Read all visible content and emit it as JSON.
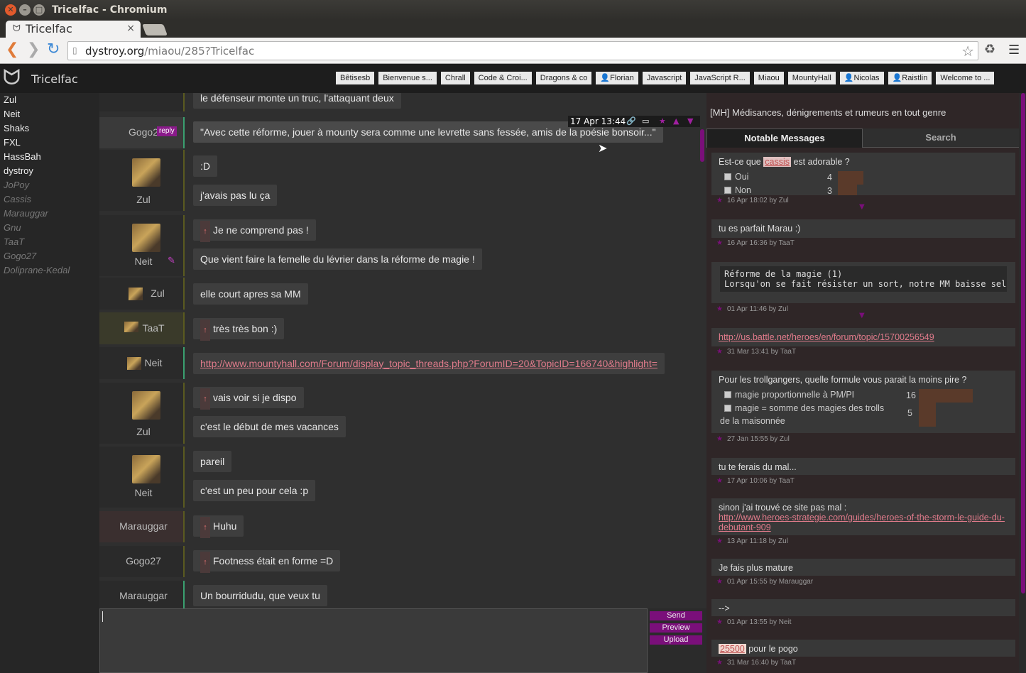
{
  "window": {
    "title": "Tricelfac - Chromium"
  },
  "browser": {
    "tab_title": "Tricelfac",
    "url_host": "dystroy.org",
    "url_path": "/miaou/285?Tricelfac"
  },
  "app": {
    "room_name": "Tricelfac",
    "room_tabs": [
      "Bêtisesb",
      "Bienvenue s...",
      "Chrall",
      "Code & Croi...",
      "Dragons & co",
      "👤Florian",
      "Javascript",
      "JavaScript R...",
      "Miaou",
      "MountyHall",
      "👤Nicolas",
      "👤Raistlin",
      "Welcome to ..."
    ]
  },
  "users": {
    "online": [
      "Zul",
      "Neit",
      "Shaks",
      "FXL",
      "HassBah",
      "dystroy"
    ],
    "offline": [
      "JoPoy",
      "Cassis",
      "Marauggar",
      "Gnu",
      "TaaT",
      "Gogo27",
      "Doliprane-Kedal"
    ]
  },
  "chat": {
    "m0": "le défenseur monte un truc, l'attaquant deux",
    "m1_author": "Gogo2",
    "m1_reply": "reply",
    "m1": "\"Avec cette réforme, jouer à mounty sera comme une levrette sans fessée, amis de la poésie bonsoir...\"",
    "m1_time": "17 Apr 13:44",
    "m2_author": "Zul",
    "m2a": ":D",
    "m2b": "j'avais pas lu ça",
    "m3_author": "Neit",
    "m3a": "Je ne comprend pas !",
    "m3b": "Que vient faire la femelle du lévrier dans la réforme de magie !",
    "m4_author": "Zul",
    "m4": "elle court apres sa MM",
    "m5_author": "TaaT",
    "m5": "très très bon :)",
    "m6_author": "Neit",
    "m6": "http://www.mountyhall.com/Forum/display_topic_threads.php?ForumID=20&TopicID=166740&highlight=",
    "m7_author": "Zul",
    "m7a": "vais voir si je dispo",
    "m7b": "c'est le début de mes vacances",
    "m8_author": "Neit",
    "m8a": "pareil",
    "m8b": "c'est un peu pour cela :p",
    "m9_author": "Marauggar",
    "m9": "Huhu",
    "m10_author": "Gogo27",
    "m10": "Footness était en forme =D",
    "m11_author": "Marauggar",
    "m11": "Un bourridudu, que veux tu",
    "send": "Send",
    "preview": "Preview",
    "upload": "Upload"
  },
  "panel": {
    "description": "[MH] Médisances, dénigrements et rumeurs en tout genre",
    "tab_notable": "Notable Messages",
    "tab_search": "Search",
    "n1_pre": "Est-ce que",
    "n1_hl": "cassis",
    "n1_post": "est adorable ?",
    "n1_opt1": "Oui",
    "n1_v1": "4",
    "n1_opt2": "Non",
    "n1_v2": "3",
    "n1_meta": "16 Apr 18:02 by Zul",
    "n2": "tu es parfait Marau :)",
    "n2_meta": "16 Apr 16:36 by TaaT",
    "n3_l1": "Réforme de la magie (1)",
    "n3_l2": "Lorsqu'on se fait résister un sort, notre MM baisse sel",
    "n3_meta": "01 Apr 11:46 by Zul",
    "n4": "http://us.battle.net/heroes/en/forum/topic/15700256549",
    "n4_meta": "31 Mar 13:41 by TaaT",
    "n5": "Pour les trollgangers, quelle formule vous parait la moins pire ?",
    "n5_opt1": "magie proportionnelle à PM/PI",
    "n5_v1": "16",
    "n5_opt2": "magie = somme des magies des trolls",
    "n5_v2": "5",
    "n5_opt2b": "de la maisonnée",
    "n5_meta": "27 Jan 15:55 by Zul",
    "n6": "tu te ferais du mal...",
    "n6_meta": "17 Apr 10:06 by TaaT",
    "n7": "sinon j'ai trouvé ce site pas mal :",
    "n7_link1": "http://www.heroes-strategie.com/guides/heroes-of-the-storm-le-guide-du-",
    "n7_link2": "debutant-909",
    "n7_meta": "13 Apr 11:18 by Zul",
    "n8": "Je fais plus mature",
    "n8_meta": "01 Apr 15:55 by Marauggar",
    "n9": "-->",
    "n9_meta": "01 Apr 13:55 by Neit",
    "n10_hl": "25500",
    "n10": "pour le pogo",
    "n10_meta": "31 Mar 16:40 by TaaT"
  }
}
